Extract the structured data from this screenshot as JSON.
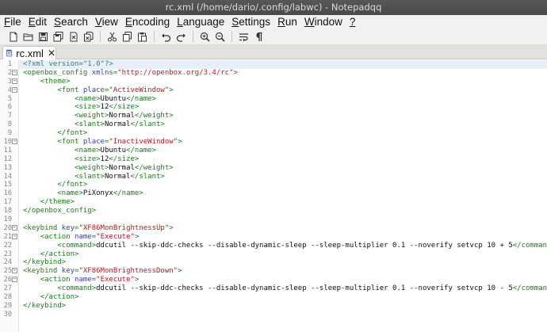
{
  "window": {
    "title": "rc.xml (/home/dario/.config/labwc) - Notepadqq"
  },
  "menubar": {
    "items": [
      {
        "u": "F",
        "rest": "ile"
      },
      {
        "u": "E",
        "rest": "dit"
      },
      {
        "u": "S",
        "rest": "earch"
      },
      {
        "u": "V",
        "rest": "iew"
      },
      {
        "u": "E",
        "rest": "ncoding"
      },
      {
        "u": "L",
        "rest": "anguage"
      },
      {
        "u": "S",
        "rest": "ettings"
      },
      {
        "u": "R",
        "rest": "un"
      },
      {
        "u": "W",
        "rest": "indow"
      },
      {
        "u": "?",
        "rest": ""
      }
    ]
  },
  "toolbar": {
    "buttons": [
      "new-file-icon",
      "open-file-icon",
      "save-icon",
      "save-all-icon",
      "close-file-icon",
      "close-all-icon",
      "sep",
      "cut-icon",
      "copy-icon",
      "paste-icon",
      "sep",
      "undo-icon",
      "redo-icon",
      "sep",
      "zoom-in-icon",
      "zoom-out-icon",
      "sep",
      "word-wrap-icon",
      "show-whitespace-icon"
    ]
  },
  "tab": {
    "label": "rc.xml",
    "close": "✕"
  },
  "editor": {
    "current_line": 1,
    "lines": [
      {
        "n": "1",
        "fold": false,
        "seg": [
          [
            "decl",
            "<?xml version=\"1.0\"?>"
          ]
        ]
      },
      {
        "n": "2",
        "fold": true,
        "seg": [
          [
            "tag",
            "<openbox_config "
          ],
          [
            "attr",
            "xmlns"
          ],
          [
            "tag",
            "="
          ],
          [
            "val",
            "\"http://openbox.org/3.4/rc\""
          ],
          [
            "tag",
            ">"
          ]
        ]
      },
      {
        "n": "3",
        "fold": true,
        "seg": [
          [
            "text",
            "    "
          ],
          [
            "tag",
            "<theme>"
          ]
        ]
      },
      {
        "n": "4",
        "fold": true,
        "seg": [
          [
            "text",
            "        "
          ],
          [
            "tag",
            "<font "
          ],
          [
            "attr",
            "place"
          ],
          [
            "tag",
            "="
          ],
          [
            "val",
            "\"ActiveWindow\""
          ],
          [
            "tag",
            ">"
          ]
        ]
      },
      {
        "n": "5",
        "fold": false,
        "seg": [
          [
            "text",
            "            "
          ],
          [
            "tag",
            "<name>"
          ],
          [
            "text",
            "Ubuntu"
          ],
          [
            "tag",
            "</name>"
          ]
        ]
      },
      {
        "n": "6",
        "fold": false,
        "seg": [
          [
            "text",
            "            "
          ],
          [
            "tag",
            "<size>"
          ],
          [
            "text",
            "12"
          ],
          [
            "tag",
            "</size>"
          ]
        ]
      },
      {
        "n": "7",
        "fold": false,
        "seg": [
          [
            "text",
            "            "
          ],
          [
            "tag",
            "<weight>"
          ],
          [
            "text",
            "Normal"
          ],
          [
            "tag",
            "</weight>"
          ]
        ]
      },
      {
        "n": "8",
        "fold": false,
        "seg": [
          [
            "text",
            "            "
          ],
          [
            "tag",
            "<slant>"
          ],
          [
            "text",
            "Normal"
          ],
          [
            "tag",
            "</slant>"
          ]
        ]
      },
      {
        "n": "9",
        "fold": false,
        "seg": [
          [
            "text",
            "        "
          ],
          [
            "tag",
            "</font>"
          ]
        ]
      },
      {
        "n": "10",
        "fold": true,
        "seg": [
          [
            "text",
            "        "
          ],
          [
            "tag",
            "<font "
          ],
          [
            "attr",
            "place"
          ],
          [
            "tag",
            "="
          ],
          [
            "val",
            "\"InactiveWindow\""
          ],
          [
            "tag",
            ">"
          ]
        ]
      },
      {
        "n": "11",
        "fold": false,
        "seg": [
          [
            "text",
            "            "
          ],
          [
            "tag",
            "<name>"
          ],
          [
            "text",
            "Ubuntu"
          ],
          [
            "tag",
            "</name>"
          ]
        ]
      },
      {
        "n": "12",
        "fold": false,
        "seg": [
          [
            "text",
            "            "
          ],
          [
            "tag",
            "<size>"
          ],
          [
            "text",
            "12"
          ],
          [
            "tag",
            "</size>"
          ]
        ]
      },
      {
        "n": "13",
        "fold": false,
        "seg": [
          [
            "text",
            "            "
          ],
          [
            "tag",
            "<weight>"
          ],
          [
            "text",
            "Normal"
          ],
          [
            "tag",
            "</weight>"
          ]
        ]
      },
      {
        "n": "14",
        "fold": false,
        "seg": [
          [
            "text",
            "            "
          ],
          [
            "tag",
            "<slant>"
          ],
          [
            "text",
            "Normal"
          ],
          [
            "tag",
            "</slant>"
          ]
        ]
      },
      {
        "n": "15",
        "fold": false,
        "seg": [
          [
            "text",
            "        "
          ],
          [
            "tag",
            "</font>"
          ]
        ]
      },
      {
        "n": "16",
        "fold": false,
        "seg": [
          [
            "text",
            "        "
          ],
          [
            "tag",
            "<name>"
          ],
          [
            "text",
            "PiXonyx"
          ],
          [
            "tag",
            "</name>"
          ]
        ]
      },
      {
        "n": "17",
        "fold": false,
        "seg": [
          [
            "text",
            "    "
          ],
          [
            "tag",
            "</theme>"
          ]
        ]
      },
      {
        "n": "18",
        "fold": false,
        "seg": [
          [
            "tag",
            "</openbox_config>"
          ]
        ]
      },
      {
        "n": "19",
        "fold": false,
        "seg": []
      },
      {
        "n": "20",
        "fold": true,
        "seg": [
          [
            "tag",
            "<keybind "
          ],
          [
            "attr",
            "key"
          ],
          [
            "tag",
            "="
          ],
          [
            "val",
            "\"XF86MonBrightnessUp\""
          ],
          [
            "tag",
            ">"
          ]
        ]
      },
      {
        "n": "21",
        "fold": true,
        "seg": [
          [
            "text",
            "    "
          ],
          [
            "tag",
            "<action "
          ],
          [
            "attr",
            "name"
          ],
          [
            "tag",
            "="
          ],
          [
            "val",
            "\"Execute\""
          ],
          [
            "tag",
            ">"
          ]
        ]
      },
      {
        "n": "22",
        "fold": false,
        "seg": [
          [
            "text",
            "        "
          ],
          [
            "tag",
            "<command>"
          ],
          [
            "text",
            "ddcutil --skip-ddc-checks --disable-dynamic-sleep --sleep-multiplier 0.1 --noverify setvcp 10 + 5"
          ],
          [
            "tag",
            "</command>"
          ]
        ]
      },
      {
        "n": "23",
        "fold": false,
        "seg": [
          [
            "text",
            "    "
          ],
          [
            "tag",
            "</action>"
          ]
        ]
      },
      {
        "n": "24",
        "fold": false,
        "seg": [
          [
            "tag",
            "</keybind>"
          ]
        ]
      },
      {
        "n": "25",
        "fold": true,
        "seg": [
          [
            "tag",
            "<keybind "
          ],
          [
            "attr",
            "key"
          ],
          [
            "tag",
            "="
          ],
          [
            "val",
            "\"XF86MonBrightnessDown\""
          ],
          [
            "tag",
            ">"
          ]
        ]
      },
      {
        "n": "26",
        "fold": true,
        "seg": [
          [
            "text",
            "    "
          ],
          [
            "tag",
            "<action "
          ],
          [
            "attr",
            "name"
          ],
          [
            "tag",
            "="
          ],
          [
            "val",
            "\"Execute\""
          ],
          [
            "tag",
            ">"
          ]
        ]
      },
      {
        "n": "27",
        "fold": false,
        "seg": [
          [
            "text",
            "        "
          ],
          [
            "tag",
            "<command>"
          ],
          [
            "text",
            "ddcutil --skip-ddc-checks --disable-dynamic-sleep --sleep-multiplier 0.1 --noverify setvcp 10 - 5"
          ],
          [
            "tag",
            "</command>"
          ]
        ]
      },
      {
        "n": "28",
        "fold": false,
        "seg": [
          [
            "text",
            "    "
          ],
          [
            "tag",
            "</action>"
          ]
        ]
      },
      {
        "n": "29",
        "fold": false,
        "seg": [
          [
            "tag",
            "</keybind>"
          ]
        ]
      },
      {
        "n": "30",
        "fold": false,
        "seg": []
      }
    ]
  }
}
